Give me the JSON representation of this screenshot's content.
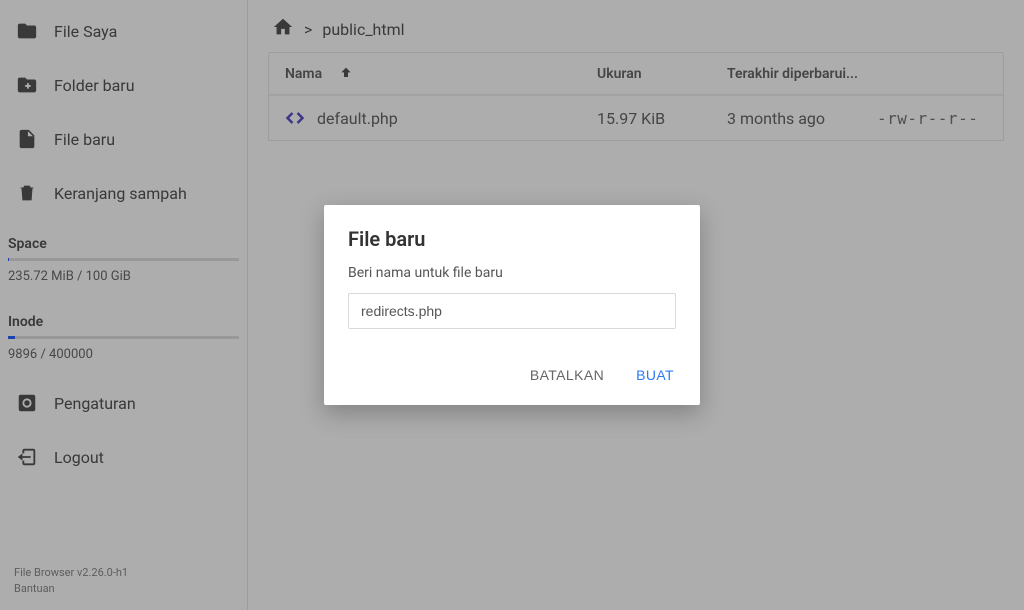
{
  "sidebar": {
    "items": [
      {
        "label": "File Saya"
      },
      {
        "label": "Folder baru"
      },
      {
        "label": "File baru"
      },
      {
        "label": "Keranjang sampah"
      },
      {
        "label": "Pengaturan"
      },
      {
        "label": "Logout"
      }
    ],
    "space": {
      "title": "Space",
      "text": "235.72 MiB / 100 GiB",
      "percent": 0.3
    },
    "inode": {
      "title": "Inode",
      "text": "9896 / 400000",
      "percent": 3
    },
    "version": "File Browser v2.26.0-h1",
    "help": "Bantuan"
  },
  "breadcrumb": {
    "separator": ">",
    "current": "public_html"
  },
  "listing": {
    "cols": {
      "name": "Nama",
      "size": "Ukuran",
      "modified": "Terakhir diperbarui..."
    },
    "rows": [
      {
        "name": "default.php",
        "size": "15.97 KiB",
        "modified": "3 months ago",
        "perm": "-rw-r--r--"
      }
    ]
  },
  "dialog": {
    "title": "File baru",
    "prompt": "Beri nama untuk file baru",
    "value": "redirects.php",
    "cancel": "BATALKAN",
    "confirm": "BUAT"
  }
}
